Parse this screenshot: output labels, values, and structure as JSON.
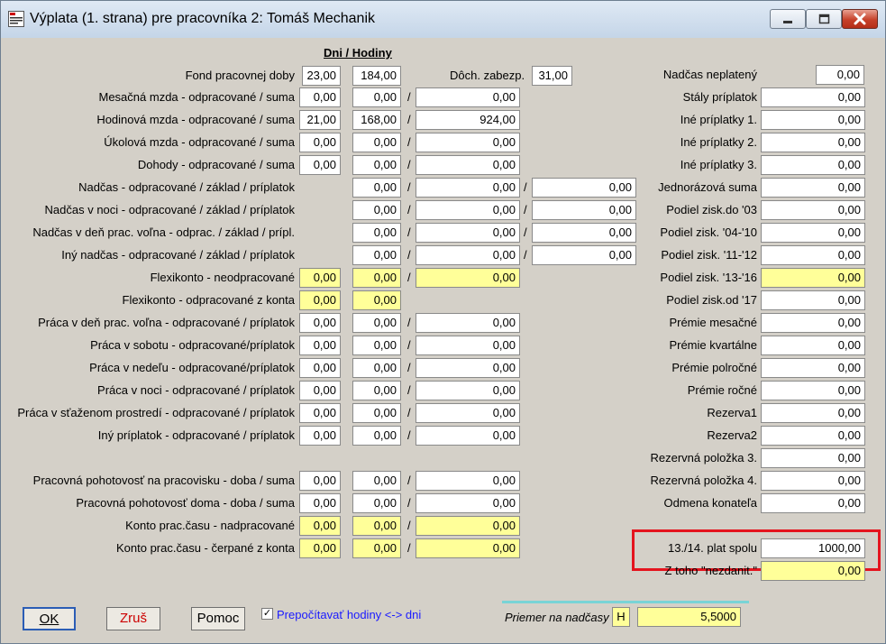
{
  "window": {
    "title": "Výplata (1. strana) pre pracovníka 2: Tomáš Mechanik"
  },
  "header": {
    "days_hours": "Dni / Hodiny"
  },
  "left": {
    "fond": {
      "label": "Fond pracovnej doby",
      "days": "23,00",
      "hours": "184,00"
    },
    "doch": {
      "label": "Dôch. zabezp.",
      "value": "31,00"
    },
    "rows": [
      {
        "label": "Mesačná mzda - odpracované / suma",
        "v1": "0,00",
        "v2": "0,00",
        "v3": "0,00"
      },
      {
        "label": "Hodinová mzda - odpracované / suma",
        "v1": "21,00",
        "v2": "168,00",
        "v3": "924,00"
      },
      {
        "label": "Úkolová mzda - odpracované / suma",
        "v1": "0,00",
        "v2": "0,00",
        "v3": "0,00"
      },
      {
        "label": "Dohody - odpracované / suma",
        "v1": "0,00",
        "v2": "0,00",
        "v3": "0,00"
      },
      {
        "label": "Nadčas - odpracované / základ / príplatok",
        "v2": "0,00",
        "v3": "0,00",
        "v4": "0,00"
      },
      {
        "label": "Nadčas v noci - odpracované / základ / príplatok",
        "v2": "0,00",
        "v3": "0,00",
        "v4": "0,00"
      },
      {
        "label": "Nadčas v deň prac. voľna - odprac. / základ / prípl.",
        "v2": "0,00",
        "v3": "0,00",
        "v4": "0,00"
      },
      {
        "label": "Iný nadčas - odpracované / základ / príplatok",
        "v2": "0,00",
        "v3": "0,00",
        "v4": "0,00"
      },
      {
        "label": "Flexikonto - neodpracované",
        "v1": "0,00",
        "v2": "0,00",
        "v3": "0,00"
      },
      {
        "label": "Flexikonto - odpracované z konta",
        "v1": "0,00",
        "v2": "0,00"
      },
      {
        "label": "Práca v deň prac. voľna - odpracované / príplatok",
        "v1": "0,00",
        "v2": "0,00",
        "v3": "0,00"
      },
      {
        "label": "Práca v sobotu - odpracované/príplatok",
        "v1": "0,00",
        "v2": "0,00",
        "v3": "0,00"
      },
      {
        "label": "Práca v nedeľu - odpracované/príplatok",
        "v1": "0,00",
        "v2": "0,00",
        "v3": "0,00"
      },
      {
        "label": "Práca v noci - odpracované / príplatok",
        "v1": "0,00",
        "v2": "0,00",
        "v3": "0,00"
      },
      {
        "label": "Práca v sťaženom prostredí - odpracované / príplatok",
        "v1": "0,00",
        "v2": "0,00",
        "v3": "0,00"
      },
      {
        "label": "Iný príplatok - odpracované / príplatok",
        "v1": "0,00",
        "v2": "0,00",
        "v3": "0,00"
      },
      {
        "label": "Pracovná pohotovosť na pracovisku - doba / suma",
        "v1": "0,00",
        "v2": "0,00",
        "v3": "0,00"
      },
      {
        "label": "Pracovná pohotovosť doma - doba / suma",
        "v1": "0,00",
        "v2": "0,00",
        "v3": "0,00"
      },
      {
        "label": "Konto prac.času - nadpracované",
        "v1": "0,00",
        "v2": "0,00",
        "v3": "0,00"
      },
      {
        "label": "Konto prac.času - čerpané z konta",
        "v1": "0,00",
        "v2": "0,00",
        "v3": "0,00"
      }
    ]
  },
  "right": {
    "rows": [
      {
        "label": "Nadčas neplatený",
        "value": "0,00"
      },
      {
        "label": "Stály príplatok",
        "value": "0,00"
      },
      {
        "label": "Iné príplatky 1.",
        "value": "0,00"
      },
      {
        "label": "Iné príplatky 2.",
        "value": "0,00"
      },
      {
        "label": "Iné príplatky 3.",
        "value": "0,00"
      },
      {
        "label": "Jednorázová suma",
        "value": "0,00"
      },
      {
        "label": "Podiel zisk.do '03",
        "value": "0,00"
      },
      {
        "label": "Podiel zisk. '04-'10",
        "value": "0,00"
      },
      {
        "label": "Podiel zisk. '11-'12",
        "value": "0,00"
      },
      {
        "label": "Podiel zisk. '13-'16",
        "value": "0,00"
      },
      {
        "label": "Podiel zisk.od '17",
        "value": "0,00"
      },
      {
        "label": "Prémie mesačné",
        "value": "0,00"
      },
      {
        "label": "Prémie kvartálne",
        "value": "0,00"
      },
      {
        "label": "Prémie polročné",
        "value": "0,00"
      },
      {
        "label": "Prémie ročné",
        "value": "0,00"
      },
      {
        "label": "Rezerva1",
        "value": "0,00"
      },
      {
        "label": "Rezerva2",
        "value": "0,00"
      },
      {
        "label": "Rezervná položka 3.",
        "value": "0,00"
      },
      {
        "label": "Rezervná položka 4.",
        "value": "0,00"
      },
      {
        "label": "Odmena konateľa",
        "value": "0,00"
      },
      {
        "label": "13./14. plat  spolu",
        "value": "1000,00"
      },
      {
        "label": "Z toho \"nezdanit.\"",
        "value": "0,00"
      }
    ]
  },
  "bottom": {
    "ok": "OK",
    "cancel": "Zruš",
    "help": "Pomoc",
    "checkbox_label": "Prepočítavať hodiny <-> dni",
    "checkbox_checked": "✓",
    "avg_label": "Priemer na nadčasy",
    "avg_unit": "H",
    "avg_value": "5,5000"
  },
  "colors": {
    "yellow_field": "#ffff99",
    "highlight": "#e4141e",
    "accent_line": "#79d4d6"
  }
}
